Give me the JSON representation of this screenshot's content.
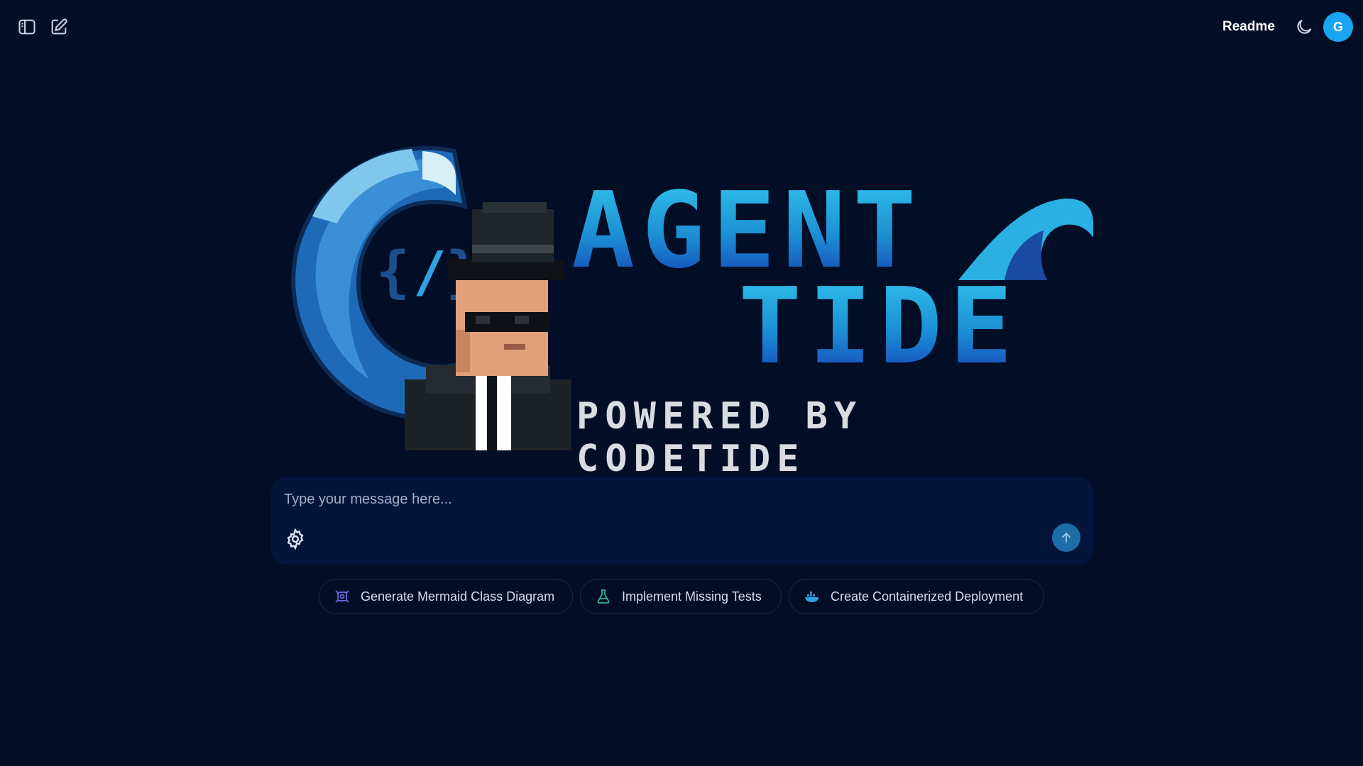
{
  "header": {
    "sidebar_toggle_icon": "sidebar-panel-icon",
    "new_chat_icon": "edit-pencil-icon",
    "readme_label": "Readme",
    "theme_icon": "moon-icon",
    "avatar_initial": "G"
  },
  "hero": {
    "title_line_1": "AGENT",
    "title_line_2": "TIDE",
    "subtitle": "POWERED BY CODETIDE",
    "logo_icons": [
      "code-wave-logo",
      "pixel-agent-mascot",
      "wave-icon"
    ]
  },
  "composer": {
    "placeholder": "Type your message here...",
    "value": "",
    "settings_icon": "gear-icon",
    "send_icon": "arrow-up-icon"
  },
  "suggestions": [
    {
      "label": "Generate Mermaid Class Diagram",
      "icon": "diagram-icon",
      "color": "#6d6cf0"
    },
    {
      "label": "Implement Missing Tests",
      "icon": "flask-icon",
      "color": "#2fb58a"
    },
    {
      "label": "Create Containerized Deployment",
      "icon": "container-icon",
      "color": "#2aa3e6"
    }
  ],
  "colors": {
    "background": "#020d26",
    "composer_bg": "#03153a",
    "accent": "#1aa5f2",
    "send_button": "#1d6ea8"
  }
}
